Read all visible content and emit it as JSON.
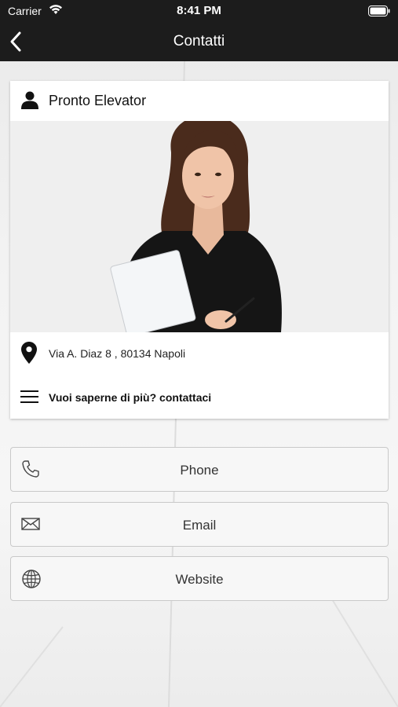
{
  "status_bar": {
    "carrier": "Carrier",
    "time": "8:41 PM"
  },
  "nav": {
    "title": "Contatti"
  },
  "card": {
    "name": "Pronto Elevator",
    "address": "Via A. Diaz 8 , 80134 Napoli",
    "more_info": "Vuoi saperne di più? contattaci"
  },
  "buttons": [
    {
      "label": "Phone",
      "icon": "phone-icon"
    },
    {
      "label": "Email",
      "icon": "envelope-icon"
    },
    {
      "label": "Website",
      "icon": "globe-icon"
    }
  ],
  "colors": {
    "bar": "#1c1c1c",
    "card": "#ffffff",
    "button": "#f7f7f7"
  }
}
